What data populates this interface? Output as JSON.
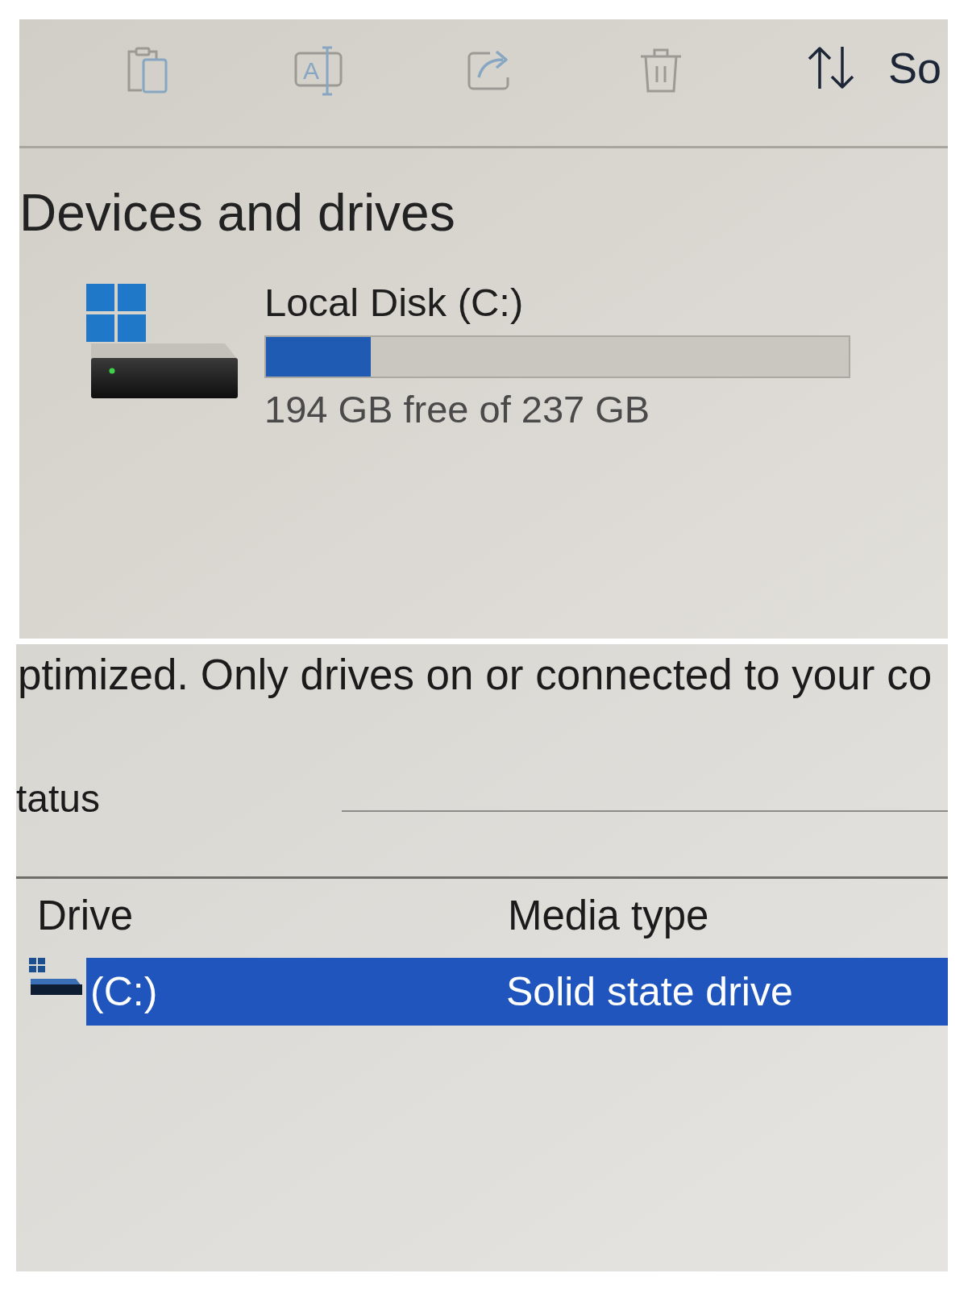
{
  "toolbar": {
    "buttons": [
      {
        "kind": "paste",
        "disabled": true
      },
      {
        "kind": "rename",
        "glyph": "A",
        "disabled": true
      },
      {
        "kind": "share",
        "disabled": true
      },
      {
        "kind": "delete",
        "disabled": true
      },
      {
        "kind": "sort",
        "label": "So",
        "disabled": false
      }
    ]
  },
  "devices": {
    "heading": "Devices and drives",
    "drives": [
      {
        "name": "Local Disk (C:)",
        "level": 0.18,
        "reading": "194 GB free of 237 GB"
      }
    ]
  },
  "optimize": {
    "description": "ptimized. Only drives on or connected to your co",
    "status_label": "tatus",
    "table": {
      "columns": [
        "Drive",
        "Media type"
      ],
      "rows": [
        {
          "cells": [
            "(C:)",
            "Solid state drive"
          ],
          "selected": true
        }
      ]
    }
  }
}
